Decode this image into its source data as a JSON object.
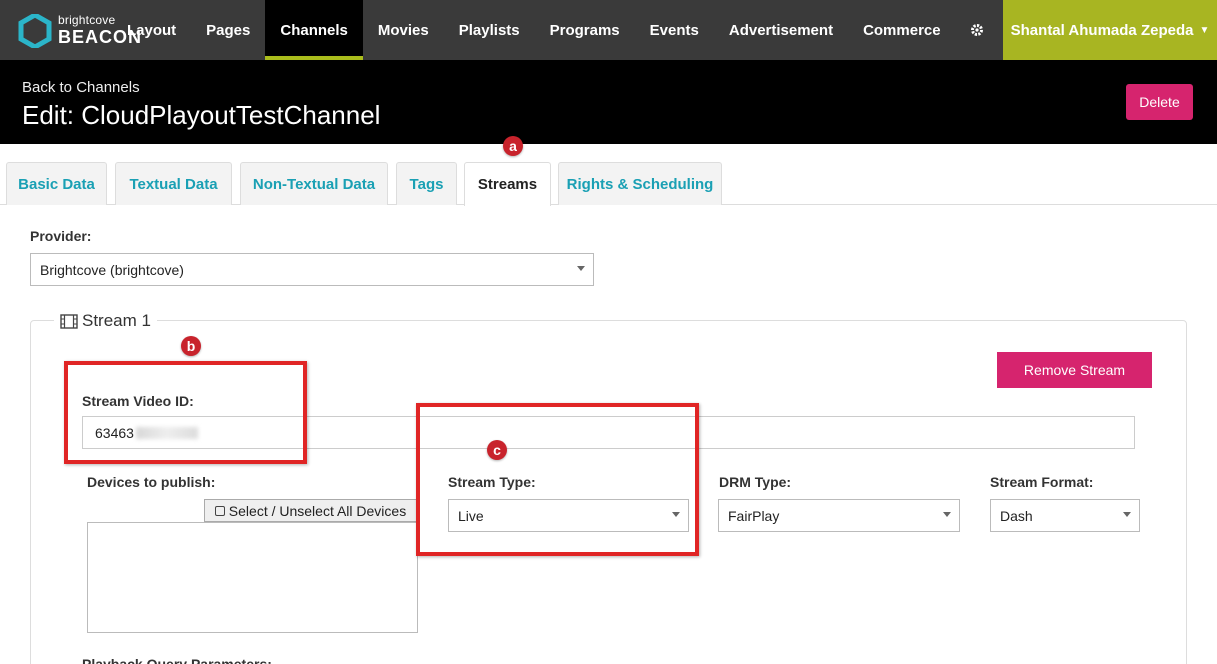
{
  "logo": {
    "small": "brightcove",
    "big": "BEACON"
  },
  "nav": {
    "items": [
      {
        "label": "Layout"
      },
      {
        "label": "Pages"
      },
      {
        "label": "Channels",
        "active": true
      },
      {
        "label": "Movies"
      },
      {
        "label": "Playlists"
      },
      {
        "label": "Programs"
      },
      {
        "label": "Events"
      },
      {
        "label": "Advertisement"
      },
      {
        "label": "Commerce"
      }
    ],
    "settings_icon": "gear-icon",
    "tools_icon": "wrench-icon",
    "user": "Shantal Ahumada Zepeda"
  },
  "header": {
    "back": "Back to Channels",
    "title": "Edit: CloudPlayoutTestChannel",
    "delete_label": "Delete"
  },
  "tabs": [
    {
      "label": "Basic Data"
    },
    {
      "label": "Textual Data"
    },
    {
      "label": "Non-Textual Data"
    },
    {
      "label": "Tags"
    },
    {
      "label": "Streams",
      "active": true
    },
    {
      "label": "Rights & Scheduling"
    }
  ],
  "annotations": {
    "a": "a",
    "b": "b",
    "c": "c"
  },
  "provider": {
    "label": "Provider:",
    "value": "Brightcove (brightcove)"
  },
  "stream": {
    "legend": "Stream 1",
    "remove_label": "Remove Stream",
    "video_id_label": "Stream Video ID:",
    "video_id_value": "63463",
    "devices_label": "Devices to publish:",
    "select_all_label": "Select / Unselect All Devices",
    "stream_type_label": "Stream Type:",
    "stream_type_value": "Live",
    "drm_type_label": "DRM Type:",
    "drm_type_value": "FairPlay",
    "stream_format_label": "Stream Format:",
    "stream_format_value": "Dash",
    "playback_label": "Playback Query Parameters:"
  },
  "colors": {
    "accent_green": "#aabd1c",
    "brand_pink": "#d6246e",
    "tab_text": "#1aa0b4",
    "annotation_red": "#e02525"
  }
}
